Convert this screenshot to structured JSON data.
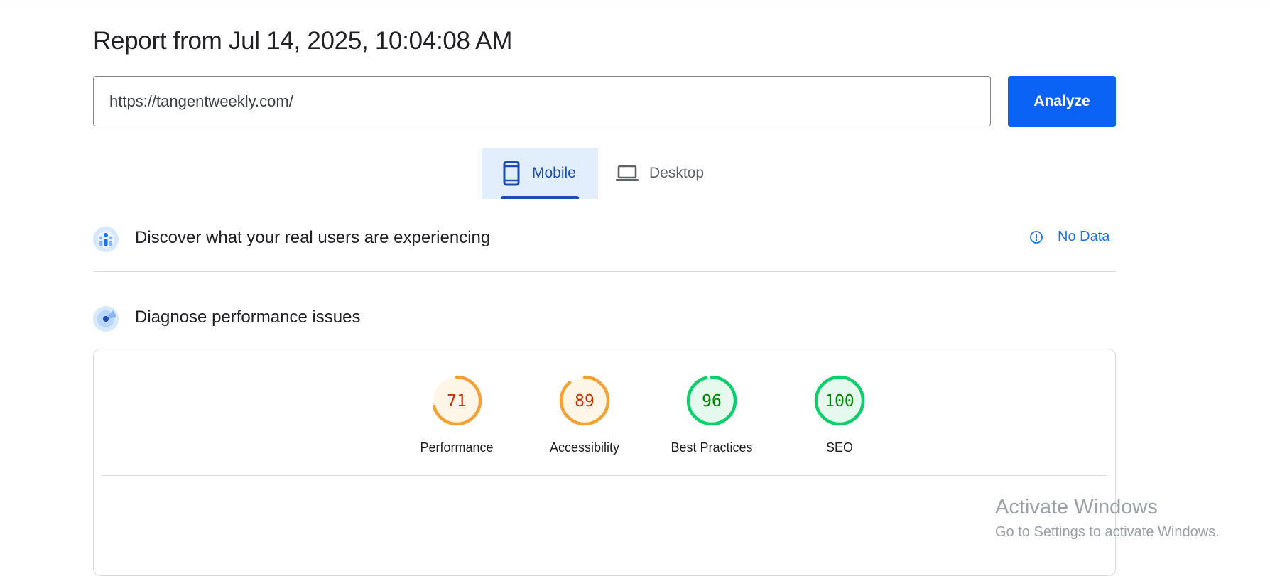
{
  "report": {
    "title": "Report from Jul 14, 2025, 10:04:08 AM"
  },
  "search": {
    "url_value": "https://tangentweekly.com/",
    "analyze_label": "Analyze"
  },
  "tabs": [
    {
      "label": "Mobile",
      "icon": "smartphone-icon",
      "selected": true
    },
    {
      "label": "Desktop",
      "icon": "laptop-icon",
      "selected": false
    }
  ],
  "field_data": {
    "title": "Discover what your real users are experiencing",
    "status": "No Data",
    "icon": "crux-users-icon"
  },
  "lab_data": {
    "title": "Diagnose performance issues",
    "icon": "lighthouse-icon",
    "scores": [
      {
        "label": "Performance",
        "score": "71",
        "fraction": 0.71,
        "color": "#f4a236",
        "text_color": "#c33300",
        "bg": "#fff6e8"
      },
      {
        "label": "Accessibility",
        "score": "89",
        "fraction": 0.89,
        "color": "#f4a236",
        "text_color": "#c33300",
        "bg": "#fff6e8"
      },
      {
        "label": "Best Practices",
        "score": "96",
        "fraction": 0.96,
        "color": "#0cce6b",
        "text_color": "#008800",
        "bg": "#e6f9ef"
      },
      {
        "label": "SEO",
        "score": "100",
        "fraction": 1.0,
        "color": "#0cce6b",
        "text_color": "#008800",
        "bg": "#e6f9ef"
      }
    ]
  },
  "colors": {
    "accent": "#0b63f6",
    "tab_selected": "#1a4fad",
    "link": "#1a73e8"
  },
  "watermark": {
    "line1": "Activate Windows",
    "line2": "Go to Settings to activate Windows."
  }
}
